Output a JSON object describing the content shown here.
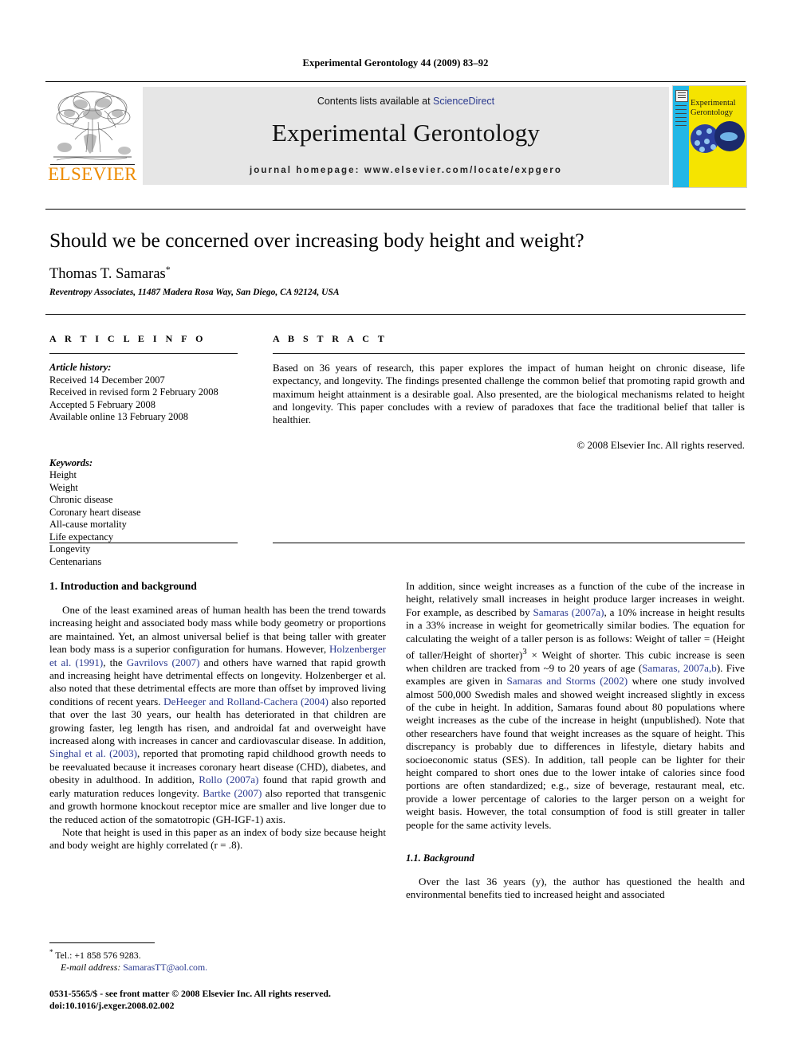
{
  "running_head": "Experimental Gerontology 44 (2009) 83–92",
  "masthead": {
    "publisher_name": "ELSEVIER",
    "contents_prefix": "Contents lists available at ",
    "contents_link": "ScienceDirect",
    "journal_title": "Experimental Gerontology",
    "homepage": "journal homepage: www.elsevier.com/locate/expgero",
    "cover_title": "Experimental Gerontology"
  },
  "article": {
    "title": "Should we be concerned over increasing body height and weight?",
    "author": "Thomas T. Samaras",
    "author_marker": "*",
    "affiliation": "Reventropy Associates, 11487 Madera Rosa Way, San Diego, CA 92124, USA"
  },
  "info": {
    "heading": "A R T I C L E  I N F O",
    "history_label": "Article history:",
    "history": [
      "Received 14 December 2007",
      "Received in revised form 2 February 2008",
      "Accepted 5 February 2008",
      "Available online 13 February 2008"
    ],
    "keywords_label": "Keywords:",
    "keywords": [
      "Height",
      "Weight",
      "Chronic disease",
      "Coronary heart disease",
      "All-cause mortality",
      "Life expectancy",
      "Longevity",
      "Centenarians"
    ]
  },
  "abstract": {
    "heading": "A B S T R A C T",
    "text": "Based on 36 years of research, this paper explores the impact of human height on chronic disease, life expectancy, and longevity. The findings presented challenge the common belief that promoting rapid growth and maximum height attainment is a desirable goal. Also presented, are the biological mechanisms related to height and longevity. This paper concludes with a review of paradoxes that face the traditional belief that taller is healthier.",
    "copyright": "© 2008 Elsevier Inc. All rights reserved."
  },
  "body": {
    "section1_heading": "1. Introduction and background",
    "left_p1_a": "One of the least examined areas of human health has been the trend towards increasing height and associated body mass while body geometry or proportions are maintained. Yet, an almost universal belief is that being taller with greater lean body mass is a superior configuration for humans. However, ",
    "cite_holzenberger": "Holzenberger et al. (1991)",
    "left_p1_b": ", the ",
    "cite_gavrilovs": "Gavrilovs (2007)",
    "left_p1_c": " and others have warned that rapid growth and increasing height have detrimental effects on longevity. Holzenberger et al. also noted that these detrimental effects are more than offset by improved living conditions of recent years. ",
    "cite_deheeger": "DeHeeger and Rolland-Cachera (2004)",
    "left_p1_d": " also reported that over the last 30 years, our health has deteriorated in that children are growing faster, leg length has risen, and androidal fat and overweight have increased along with increases in cancer and cardiovascular disease. In addition, ",
    "cite_singhal": "Singhal et al. (2003)",
    "left_p1_e": ", reported that promoting rapid childhood growth needs to be reevaluated because it increases coronary heart disease (CHD), diabetes, and obesity in adulthood. In addition, ",
    "cite_rollo": "Rollo (2007a)",
    "left_p1_f": " found that rapid growth and early maturation reduces longevity. ",
    "cite_bartke": "Bartke (2007)",
    "left_p1_g": " also reported that transgenic and growth hormone knockout receptor mice are smaller and live longer due to the reduced action of the somatotropic (GH-IGF-1) axis.",
    "left_p2": "Note that height is used in this paper as an index of body size because height and body weight are highly correlated (r = .8).",
    "right_p1_a": "In addition, since weight increases as a function of the cube of the increase in height, relatively small increases in height produce larger increases in weight. For example, as described by ",
    "cite_samaras_2007a": "Samaras (2007a)",
    "right_p1_b": ", a 10% increase in height results in a 33% increase in weight for geometrically similar bodies. The equation for calculating the weight of a taller person is as follows: Weight of taller = (Height of taller/Height of shorter)",
    "right_p1_exp": "3",
    "right_p1_c": " × Weight of shorter. This cubic increase is seen when children are tracked from ~9 to 20 years of age (",
    "cite_samaras_2007ab": "Samaras, 2007a,b",
    "right_p1_d": "). Five examples are given in ",
    "cite_samaras_storms": "Samaras and Storms (2002)",
    "right_p1_e": " where one study involved almost 500,000 Swedish males and showed weight increased slightly in excess of the cube in height. In addition, Samaras found about 80 populations where weight increases as the cube of the increase in height (unpublished). Note that other researchers have found that weight increases as the square of height. This discrepancy is probably due to differences in lifestyle, dietary habits and socioeconomic status (SES). In addition, tall people can be lighter for their height compared to short ones due to the lower intake of calories since food portions are often standardized; e.g., size of beverage, restaurant meal, etc. provide a lower percentage of calories to the larger person on a weight for weight basis. However, the total consumption of food is still greater in taller people for the same activity levels.",
    "subsection_heading": "1.1. Background",
    "right_p2": "Over the last 36 years (y), the author has questioned the health and environmental benefits tied to increased height and associated"
  },
  "footnote": {
    "marker": "*",
    "tel": "Tel.: +1 858 576 9283.",
    "email_label": "E-mail address:",
    "email": "SamarasTT@aol.com."
  },
  "footer": {
    "issn_line": "0531-5565/$ - see front matter © 2008 Elsevier Inc. All rights reserved.",
    "doi_line": "doi:10.1016/j.exger.2008.02.002"
  },
  "colors": {
    "link_blue": "#2b3a8f",
    "elsevier_orange": "#ED8B00",
    "cover_yellow": "#f5e400",
    "cover_cyan": "#22b7e6",
    "band_grey": "#e6e6e6"
  }
}
